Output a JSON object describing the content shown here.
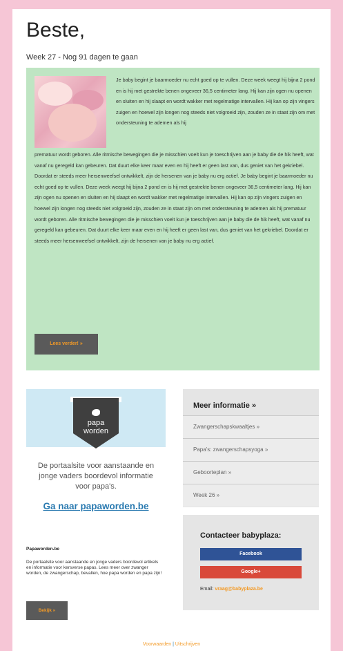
{
  "greeting": "Beste,",
  "week_line": "Week 27 - Nog 91 dagen te gaan",
  "article": {
    "para1": "Je baby begint je baarmoeder nu echt goed op te vullen. Deze week weegt hij bijna 2 pond en is hij met gestrekte benen ongeveer 36,5 centimeter lang. Hij kan zijn ogen nu openen en sluiten en hij slaapt en wordt wakker met regelmatige intervallen. Hij kan op zijn vingers zuigen en hoewel zijn longen nog steeds niet volgroeid zijn, zouden ze in staat zijn om met ondersteuning te ademen als hij",
    "para2": "prematuur wordt geboren. Alle ritmische bewegingen die je misschien voelt kun je toeschrijven aan je baby die de hik heeft, wat vanaf nu geregeld kan gebeuren. Dat duurt elke keer maar even en hij heeft er geen last van, dus geniet van het gekriebel. Doordat er steeds meer hersenweefsel ontwikkelt, zijn de hersenen van je baby nu erg actief. Je baby begint je baarmoeder nu echt goed op te vullen. Deze week weegt hij bijna 2 pond en is hij met gestrekte benen ongeveer 36,5 centimeter lang. Hij kan zijn ogen nu openen en sluiten en hij slaapt en wordt wakker met regelmatige intervallen. Hij kan op zijn vingers zuigen en hoewel zijn longen nog steeds niet volgroeid zijn, zouden ze in staat zijn om met ondersteuning te ademen als hij prematuur wordt geboren. Alle ritmische bewegingen die je misschien voelt kun je toeschrijven aan je baby die de hik heeft, wat vanaf nu geregeld kan gebeuren. Dat duurt elke keer maar even en hij heeft er geen last van, dus geniet van het gekriebel. Doordat er steeds meer hersenweefsel ontwikkelt, zijn de hersenen van je baby nu erg actief.",
    "read_more": "Lees verder! »"
  },
  "papaworden": {
    "logo_line1": "papa",
    "logo_line2": "worden",
    "tagline": "De portaalsite voor aanstaande en jonge vaders boordevol informatie voor papa's.",
    "link": "Ga naar papaworden.be",
    "title": "Papaworden.be",
    "body": "De portaalsite voor aanstaande en jonge vaders boordevol artikels en informatie voor kersverse papas. Lees meer over zwanger worden, de zwangerschap, bevallen, hoe papa worden en papa zijn!",
    "button": "Bekijk »"
  },
  "more_info": {
    "title": "Meer informatie »",
    "items": [
      "Zwangerschapskwaaltjes »",
      "Papa's: zwangerschapsyoga »",
      "Geboorteplan »",
      "Week 26 »"
    ]
  },
  "contact": {
    "title": "Contacteer babyplaza:",
    "facebook": "Facebook",
    "google": "Google+",
    "email_label": "Email:",
    "email_value": "vraag@babyplaza.be"
  },
  "footer": {
    "link1": "Voorwaarden",
    "separator": "|",
    "link2": "Uitschrijven"
  },
  "colors": {
    "page_bg": "#f6c6d6",
    "article_bg": "#bfe5c3",
    "accent": "#f39a26",
    "link": "#2a7ab0"
  }
}
